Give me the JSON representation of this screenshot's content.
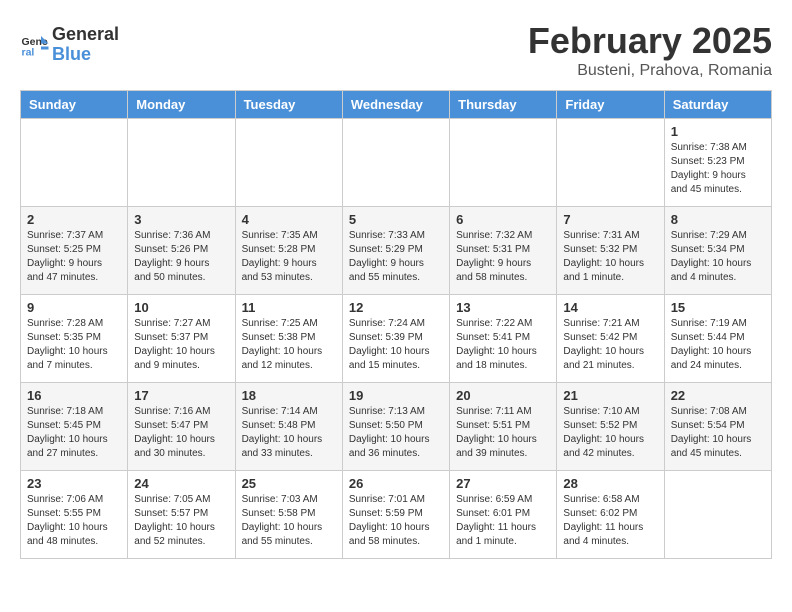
{
  "header": {
    "logo_line1": "General",
    "logo_line2": "Blue",
    "title": "February 2025",
    "subtitle": "Busteni, Prahova, Romania"
  },
  "days_of_week": [
    "Sunday",
    "Monday",
    "Tuesday",
    "Wednesday",
    "Thursday",
    "Friday",
    "Saturday"
  ],
  "weeks": [
    [
      {
        "day": "",
        "info": ""
      },
      {
        "day": "",
        "info": ""
      },
      {
        "day": "",
        "info": ""
      },
      {
        "day": "",
        "info": ""
      },
      {
        "day": "",
        "info": ""
      },
      {
        "day": "",
        "info": ""
      },
      {
        "day": "1",
        "info": "Sunrise: 7:38 AM\nSunset: 5:23 PM\nDaylight: 9 hours and 45 minutes."
      }
    ],
    [
      {
        "day": "2",
        "info": "Sunrise: 7:37 AM\nSunset: 5:25 PM\nDaylight: 9 hours and 47 minutes."
      },
      {
        "day": "3",
        "info": "Sunrise: 7:36 AM\nSunset: 5:26 PM\nDaylight: 9 hours and 50 minutes."
      },
      {
        "day": "4",
        "info": "Sunrise: 7:35 AM\nSunset: 5:28 PM\nDaylight: 9 hours and 53 minutes."
      },
      {
        "day": "5",
        "info": "Sunrise: 7:33 AM\nSunset: 5:29 PM\nDaylight: 9 hours and 55 minutes."
      },
      {
        "day": "6",
        "info": "Sunrise: 7:32 AM\nSunset: 5:31 PM\nDaylight: 9 hours and 58 minutes."
      },
      {
        "day": "7",
        "info": "Sunrise: 7:31 AM\nSunset: 5:32 PM\nDaylight: 10 hours and 1 minute."
      },
      {
        "day": "8",
        "info": "Sunrise: 7:29 AM\nSunset: 5:34 PM\nDaylight: 10 hours and 4 minutes."
      }
    ],
    [
      {
        "day": "9",
        "info": "Sunrise: 7:28 AM\nSunset: 5:35 PM\nDaylight: 10 hours and 7 minutes."
      },
      {
        "day": "10",
        "info": "Sunrise: 7:27 AM\nSunset: 5:37 PM\nDaylight: 10 hours and 9 minutes."
      },
      {
        "day": "11",
        "info": "Sunrise: 7:25 AM\nSunset: 5:38 PM\nDaylight: 10 hours and 12 minutes."
      },
      {
        "day": "12",
        "info": "Sunrise: 7:24 AM\nSunset: 5:39 PM\nDaylight: 10 hours and 15 minutes."
      },
      {
        "day": "13",
        "info": "Sunrise: 7:22 AM\nSunset: 5:41 PM\nDaylight: 10 hours and 18 minutes."
      },
      {
        "day": "14",
        "info": "Sunrise: 7:21 AM\nSunset: 5:42 PM\nDaylight: 10 hours and 21 minutes."
      },
      {
        "day": "15",
        "info": "Sunrise: 7:19 AM\nSunset: 5:44 PM\nDaylight: 10 hours and 24 minutes."
      }
    ],
    [
      {
        "day": "16",
        "info": "Sunrise: 7:18 AM\nSunset: 5:45 PM\nDaylight: 10 hours and 27 minutes."
      },
      {
        "day": "17",
        "info": "Sunrise: 7:16 AM\nSunset: 5:47 PM\nDaylight: 10 hours and 30 minutes."
      },
      {
        "day": "18",
        "info": "Sunrise: 7:14 AM\nSunset: 5:48 PM\nDaylight: 10 hours and 33 minutes."
      },
      {
        "day": "19",
        "info": "Sunrise: 7:13 AM\nSunset: 5:50 PM\nDaylight: 10 hours and 36 minutes."
      },
      {
        "day": "20",
        "info": "Sunrise: 7:11 AM\nSunset: 5:51 PM\nDaylight: 10 hours and 39 minutes."
      },
      {
        "day": "21",
        "info": "Sunrise: 7:10 AM\nSunset: 5:52 PM\nDaylight: 10 hours and 42 minutes."
      },
      {
        "day": "22",
        "info": "Sunrise: 7:08 AM\nSunset: 5:54 PM\nDaylight: 10 hours and 45 minutes."
      }
    ],
    [
      {
        "day": "23",
        "info": "Sunrise: 7:06 AM\nSunset: 5:55 PM\nDaylight: 10 hours and 48 minutes."
      },
      {
        "day": "24",
        "info": "Sunrise: 7:05 AM\nSunset: 5:57 PM\nDaylight: 10 hours and 52 minutes."
      },
      {
        "day": "25",
        "info": "Sunrise: 7:03 AM\nSunset: 5:58 PM\nDaylight: 10 hours and 55 minutes."
      },
      {
        "day": "26",
        "info": "Sunrise: 7:01 AM\nSunset: 5:59 PM\nDaylight: 10 hours and 58 minutes."
      },
      {
        "day": "27",
        "info": "Sunrise: 6:59 AM\nSunset: 6:01 PM\nDaylight: 11 hours and 1 minute."
      },
      {
        "day": "28",
        "info": "Sunrise: 6:58 AM\nSunset: 6:02 PM\nDaylight: 11 hours and 4 minutes."
      },
      {
        "day": "",
        "info": ""
      }
    ]
  ]
}
